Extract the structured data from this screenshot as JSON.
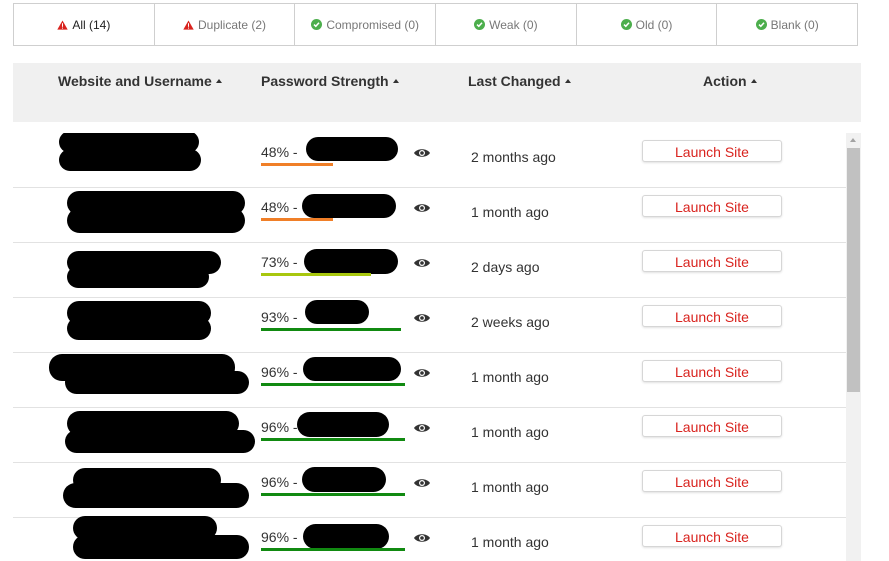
{
  "tabs": [
    {
      "label": "All (14)",
      "icon": "warning-icon",
      "active": true
    },
    {
      "label": "Duplicate (2)",
      "icon": "warning-icon"
    },
    {
      "label": "Compromised (0)",
      "icon": "check-circle-icon"
    },
    {
      "label": "Weak (0)",
      "icon": "check-circle-icon"
    },
    {
      "label": "Old (0)",
      "icon": "check-circle-icon"
    },
    {
      "label": "Blank (0)",
      "icon": "check-circle-icon"
    }
  ],
  "columns": {
    "site": "Website and Username",
    "strength": "Password Strength",
    "changed": "Last Changed",
    "action": "Action"
  },
  "colors": {
    "warning": "#d9231e",
    "ok": "#4cae4c",
    "weak_bar": "#f07f28",
    "medium_bar": "#a8c70e",
    "strong_bar": "#118a11",
    "launch_text": "#d9231e"
  },
  "rows": [
    {
      "strength": "48% - ",
      "strength_value": 48,
      "bar_color": "#f07f28",
      "changed": "2 months ago",
      "action": "Launch Site"
    },
    {
      "strength": "48% - ",
      "strength_value": 48,
      "bar_color": "#f07f28",
      "changed": "1 month ago",
      "action": "Launch Site"
    },
    {
      "strength": "73% - ",
      "strength_value": 73,
      "bar_color": "#a8c70e",
      "changed": "2 days ago",
      "action": "Launch Site"
    },
    {
      "strength": "93% - ",
      "strength_value": 93,
      "bar_color": "#118a11",
      "changed": "2 weeks ago",
      "action": "Launch Site"
    },
    {
      "strength": "96% - ",
      "strength_value": 96,
      "bar_color": "#118a11",
      "changed": "1 month ago",
      "action": "Launch Site"
    },
    {
      "strength": "96% - ",
      "strength_value": 96,
      "bar_color": "#118a11",
      "changed": "1 month ago",
      "action": "Launch Site"
    },
    {
      "strength": "96% - ",
      "strength_value": 96,
      "bar_color": "#118a11",
      "changed": "1 month ago",
      "action": "Launch Site"
    },
    {
      "strength": "96% - ",
      "strength_value": 96,
      "bar_color": "#118a11",
      "changed": "1 month ago",
      "action": "Launch Site"
    }
  ]
}
